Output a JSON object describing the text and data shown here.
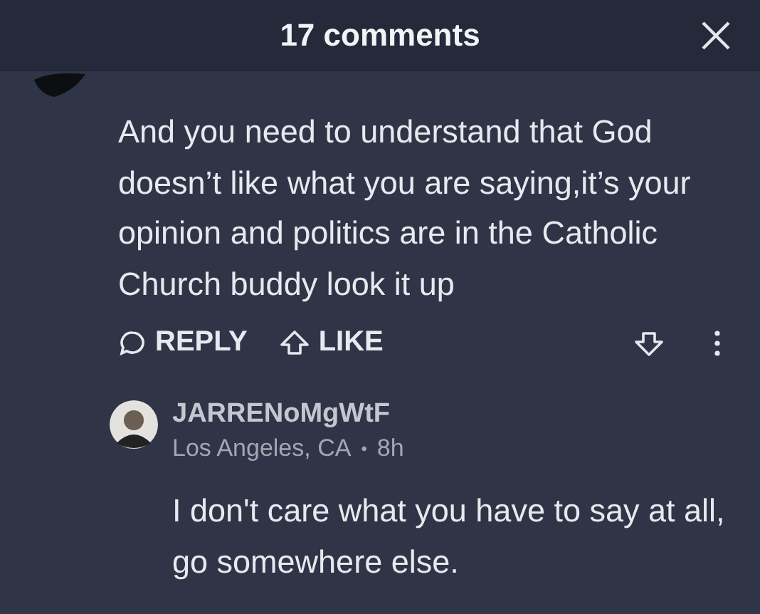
{
  "header": {
    "title": "17 comments"
  },
  "comment": {
    "text": "And you need to understand that God doesn’t like what you are saying,it’s your opinion and politics are in the Catholic Church buddy look it up",
    "actions": {
      "reply": "REPLY",
      "like": "LIKE"
    }
  },
  "reply": {
    "author": "JARRENoMgWtF",
    "location": "Los Angeles, CA",
    "separator": "•",
    "time": "8h",
    "text": "I don't care what you have to say at all, go somewhere else."
  }
}
